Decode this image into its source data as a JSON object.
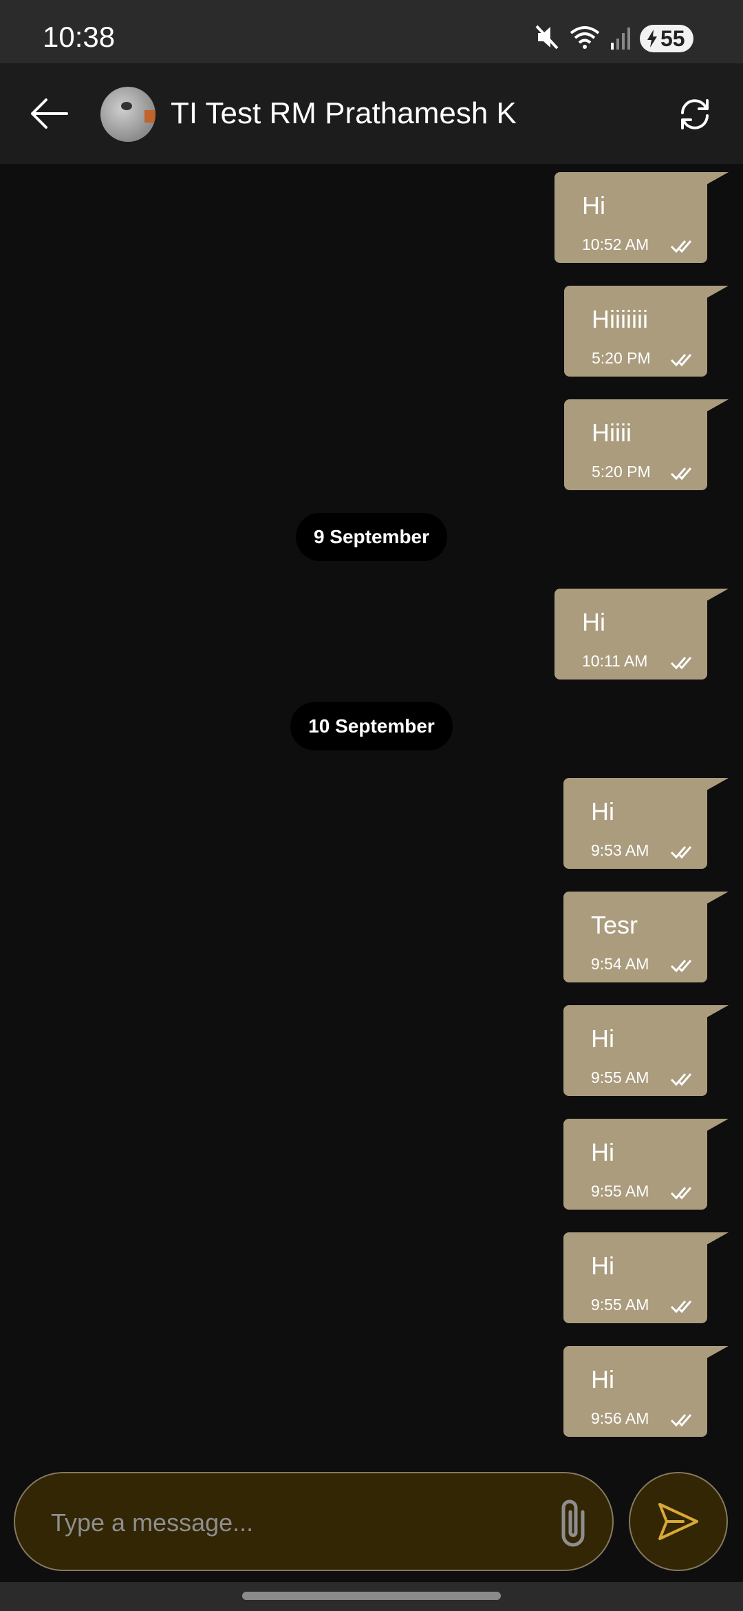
{
  "status_bar": {
    "time": "10:38",
    "battery": "55",
    "icons": [
      "mute-icon",
      "wifi-icon",
      "signal-icon",
      "battery-icon"
    ]
  },
  "header": {
    "contact_name": "TI Test RM Prathamesh K",
    "back_icon": "arrow-left-icon",
    "refresh_icon": "refresh-icon"
  },
  "messages": [
    {
      "text": "Hi",
      "time": "10:52 AM"
    },
    {
      "text": "Hiiiiiii",
      "time": "5:20 PM"
    },
    {
      "text": "Hiiii",
      "time": "5:20 PM"
    },
    {
      "text": "Hi",
      "time": "10:11 AM"
    },
    {
      "text": "Hi",
      "time": "9:53 AM"
    },
    {
      "text": "Tesr",
      "time": "9:54 AM"
    },
    {
      "text": "Hi",
      "time": "9:55 AM"
    },
    {
      "text": "Hi",
      "time": "9:55 AM"
    },
    {
      "text": "Hi",
      "time": "9:55 AM"
    },
    {
      "text": "Hi",
      "time": "9:56 AM"
    }
  ],
  "date_separators": [
    "9 September",
    "10 September"
  ],
  "composer": {
    "placeholder": "Type a message..."
  },
  "colors": {
    "bubble": "#aa9c7d",
    "accent": "#d9a935",
    "composer_bg": "#322604"
  }
}
